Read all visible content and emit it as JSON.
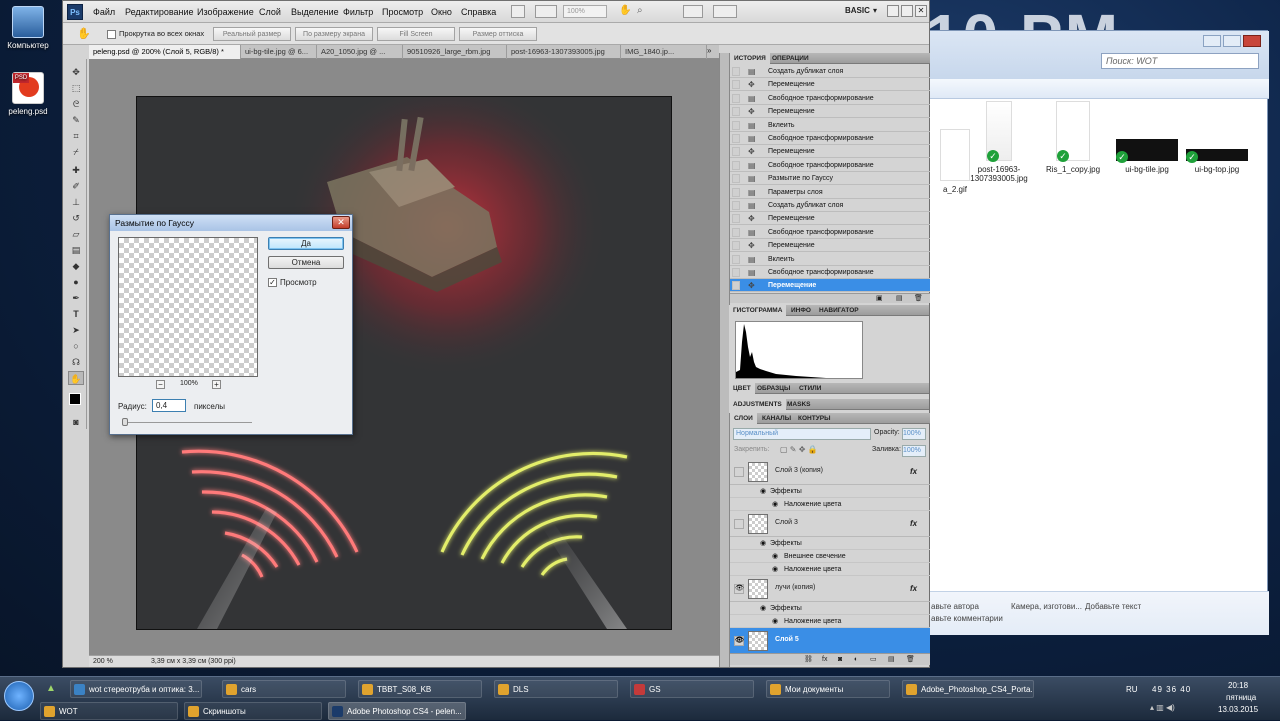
{
  "desktop": {
    "icons": [
      {
        "label": "Компьютер"
      },
      {
        "label": "peleng.psd"
      }
    ],
    "clock_big": "10 PM"
  },
  "explorer": {
    "search_placeholder": "Поиск: WOT",
    "files": [
      {
        "name": "a_2.gif"
      },
      {
        "name": "post-16963-1307393005.jpg"
      },
      {
        "name": "Ris_1_copy.jpg"
      },
      {
        "name": "ui-bg-tile.jpg"
      },
      {
        "name": "ui-bg-top.jpg"
      }
    ],
    "props": [
      "авьте автора",
      "Камера, изготови...",
      "Добавьте текст",
      "авьте комментарии"
    ]
  },
  "photoshop": {
    "logo": "Ps",
    "menus": [
      "Файл",
      "Редактирование",
      "Изображение",
      "Слой",
      "Выделение",
      "Фильтр",
      "Просмотр",
      "Окно",
      "Справка"
    ],
    "zoom_field": "100%",
    "workspace": "BASIC",
    "options": {
      "scroll_all_label": "Прокрутка во всех окнах",
      "btn_actual": "Реальный размер",
      "btn_fit": "По размеру экрана",
      "btn_fill": "Fill Screen",
      "btn_print": "Размер оттиска"
    },
    "tabs": [
      {
        "label": "peleng.psd @ 200% (Слой 5, RGB/8) *"
      },
      {
        "label": "ui-bg-tile.jpg @ 6..."
      },
      {
        "label": "A20_1050.jpg @ ..."
      },
      {
        "label": "90510926_large_rbm.jpg"
      },
      {
        "label": "post-16963-1307393005.jpg"
      },
      {
        "label": "IMG_1840.jp..."
      }
    ],
    "status": {
      "zoom": "200 %",
      "info": "3,39 см x 3,39 см (300 ppi)"
    },
    "dialog": {
      "title": "Размытие по Гауссу",
      "ok": "Да",
      "cancel": "Отмена",
      "preview_label": "Просмотр",
      "preview_zoom": "100%",
      "radius_label": "Радиус:",
      "radius_value": "0,4",
      "units": "пикселы"
    },
    "history_panel": {
      "tabs": [
        "ИСТОРИЯ",
        "ОПЕРАЦИИ"
      ],
      "items": [
        "Создать дубликат слоя",
        "Перемещение",
        "Свободное трансформирование",
        "Перемещение",
        "Вклеить",
        "Свободное трансформирование",
        "Перемещение",
        "Свободное трансформирование",
        "Размытие по Гауссу",
        "Параметры слоя",
        "Создать дубликат слоя",
        "Перемещение",
        "Свободное трансформирование",
        "Перемещение",
        "Вклеить",
        "Свободное трансформирование",
        "Перемещение"
      ]
    },
    "histogram_panel": {
      "tabs": [
        "ГИСТОГРАММА",
        "ИНФО",
        "НАВИГАТОР"
      ]
    },
    "color_panel": {
      "tabs": [
        "ЦВЕТ",
        "ОБРАЗЦЫ",
        "СТИЛИ"
      ]
    },
    "adj_panel": {
      "tabs": [
        "ADJUSTMENTS",
        "MASKS"
      ]
    },
    "layers_panel": {
      "tabs": [
        "СЛОИ",
        "КАНАЛЫ",
        "КОНТУРЫ"
      ],
      "blend_mode": "Нормальный",
      "opacity_label": "Opacity:",
      "opacity": "100%",
      "lock_label": "Закрепить:",
      "fill_label": "Заливка:",
      "fill": "100%",
      "fx": "fx",
      "effects_label": "Эффекты",
      "layers": [
        {
          "name": "Слой 3 (копия)",
          "effects": [
            "Наложение цвета"
          ]
        },
        {
          "name": "Слой 3",
          "effects": [
            "Внешнее свечение",
            "Наложение цвета"
          ]
        },
        {
          "name": "лучи (копия)",
          "effects": [
            "Наложение цвета"
          ]
        },
        {
          "name": "Слой 5",
          "effects": []
        }
      ]
    }
  },
  "taskbar": {
    "row1": [
      {
        "label": "wot стереотруба и оптика: 3..."
      },
      {
        "label": "cars"
      },
      {
        "label": "TBBT_S08_KB"
      },
      {
        "label": "DLS"
      },
      {
        "label": "GS"
      },
      {
        "label": "Мои документы"
      },
      {
        "label": "Adobe_Photoshop_CS4_Porta..."
      }
    ],
    "row2": [
      {
        "label": "WOT"
      },
      {
        "label": "Скриншоты"
      },
      {
        "label": "Adobe Photoshop CS4 - pelen..."
      }
    ],
    "lang": "RU",
    "tray_numbers": "49 36 40",
    "time": "20:18",
    "day": "пятница",
    "date": "13.03.2015"
  }
}
